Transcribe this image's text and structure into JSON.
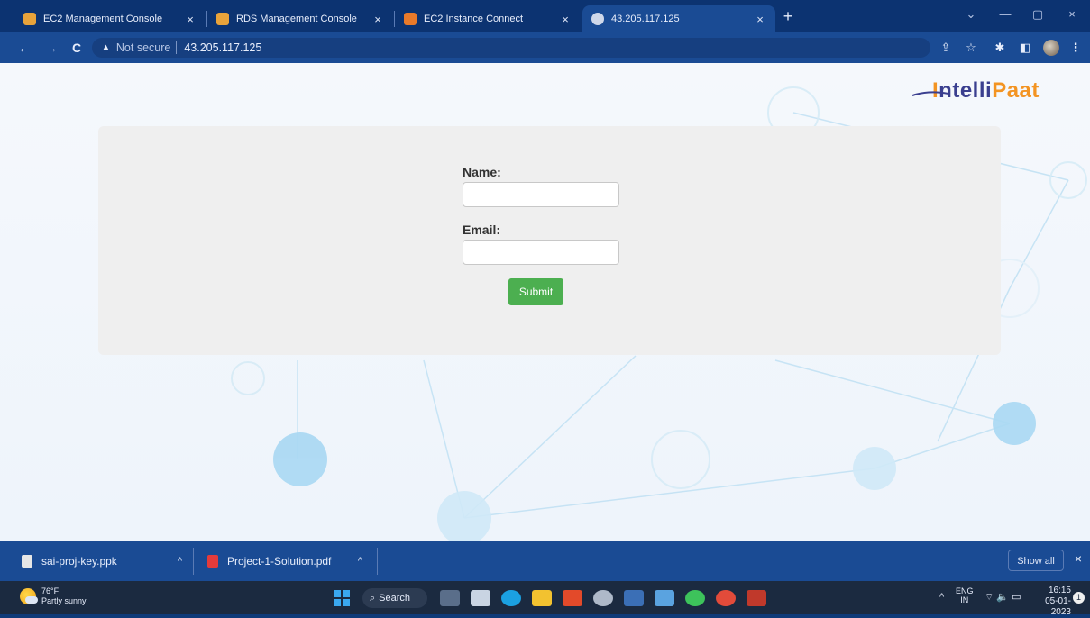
{
  "browser": {
    "tabs": [
      {
        "label": "EC2 Management Console",
        "icon": "aws-cube-icon",
        "active": false,
        "close": "×"
      },
      {
        "label": "RDS Management Console",
        "icon": "aws-cube-icon",
        "active": false,
        "close": "×"
      },
      {
        "label": "EC2 Instance Connect",
        "icon": "aws-cube-icon",
        "active": false,
        "close": "×"
      },
      {
        "label": "43.205.117.125",
        "icon": "globe-icon",
        "active": true,
        "close": "×"
      }
    ],
    "new_tab": "+",
    "window_controls": {
      "dropdown": "⌄",
      "minimize": "—",
      "maximize": "▢",
      "close": "×"
    },
    "nav": {
      "back": "←",
      "forward": "→",
      "reload": "C"
    },
    "address": {
      "warning_icon": "▲",
      "not_secure": "Not secure",
      "url": "43.205.117.125"
    },
    "toolbar": {
      "share": "⇪",
      "bookmark": "☆",
      "extensions": "✱",
      "sidepanel": "◧",
      "menu": "⋮"
    }
  },
  "page": {
    "logo": {
      "brand_main": "ntelli",
      "brand_accent": "Paat",
      "brand_first": "I"
    },
    "form": {
      "name_label": "Name:",
      "name_value": "",
      "email_label": "Email:",
      "email_value": "",
      "submit_label": "Submit"
    }
  },
  "downloads": {
    "items": [
      {
        "label": "sai-proj-key.ppk",
        "chevron": "^"
      },
      {
        "label": "Project-1-Solution.pdf",
        "chevron": "^"
      }
    ],
    "show_all": "Show all",
    "close": "×"
  },
  "taskbar": {
    "weather": {
      "temp": "76°F",
      "desc": "Partly sunny"
    },
    "search_label": "Search",
    "tray": {
      "chevron": "^",
      "lang_top": "ENG",
      "lang_bottom": "IN",
      "icons": "⌔ 🔈 ▭"
    },
    "clock": {
      "time": "16:15",
      "date": "05-01-2023"
    },
    "notifications": "1"
  },
  "colors": {
    "tabstrip": "#0c3371",
    "toolbar": "#1a4b94",
    "submit": "#4caf50",
    "card": "#efefef",
    "logo_orange": "#f39422",
    "logo_navy": "#3a3f8f"
  }
}
